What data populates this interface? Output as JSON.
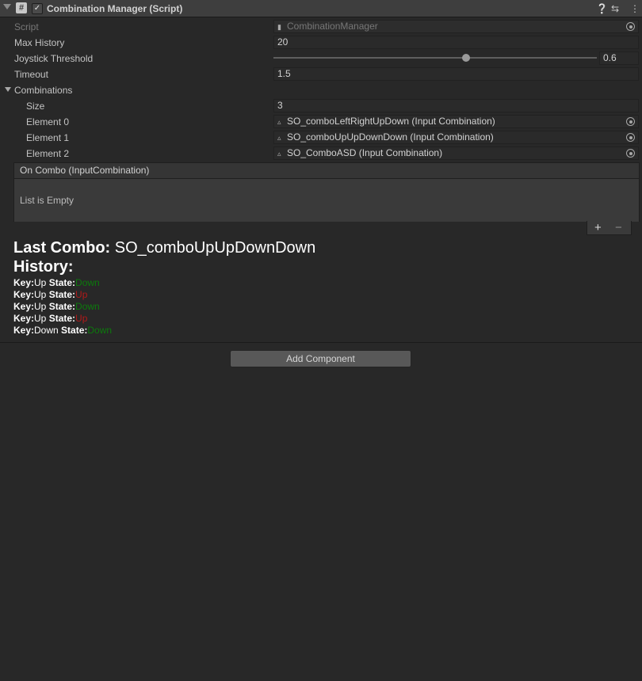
{
  "component": {
    "title": "Combination Manager (Script)",
    "enabled_check": "✓",
    "icons": [
      "help-icon",
      "preset-icon",
      "kebab-menu-icon"
    ]
  },
  "fields": {
    "script": {
      "label": "Script",
      "value": "CombinationManager"
    },
    "max_history": {
      "label": "Max History",
      "value": "20"
    },
    "joystick_threshold": {
      "label": "Joystick Threshold",
      "value": "0.6",
      "slider_fraction": 0.6
    },
    "timeout": {
      "label": "Timeout",
      "value": "1.5"
    }
  },
  "combinations": {
    "label": "Combinations",
    "size_label": "Size",
    "size_value": "3",
    "elements": [
      {
        "label": "Element 0",
        "value": "SO_comboLeftRightUpDown (Input Combination)"
      },
      {
        "label": "Element 1",
        "value": "SO_comboUpUpDownDown (Input Combination)"
      },
      {
        "label": "Element 2",
        "value": "SO_ComboASD (Input Combination)"
      }
    ]
  },
  "on_combo": {
    "header": "On Combo (InputCombination)",
    "empty_text": "List is Empty",
    "plus": "+",
    "minus": "−"
  },
  "last_combo": {
    "label": "Last Combo:",
    "value": "SO_comboUpUpDownDown"
  },
  "history": {
    "label": "History:",
    "key_label": "Key:",
    "state_label": "State:",
    "entries": [
      {
        "key": "Up",
        "state": "Down",
        "color": "#0c7a0c"
      },
      {
        "key": "Up",
        "state": "Up",
        "color": "#b01a1a"
      },
      {
        "key": "Up",
        "state": "Down",
        "color": "#0c7a0c"
      },
      {
        "key": "Up",
        "state": "Up",
        "color": "#b01a1a"
      },
      {
        "key": "Down",
        "state": "Down",
        "color": "#0c7a0c"
      }
    ]
  },
  "add_component": "Add Component"
}
